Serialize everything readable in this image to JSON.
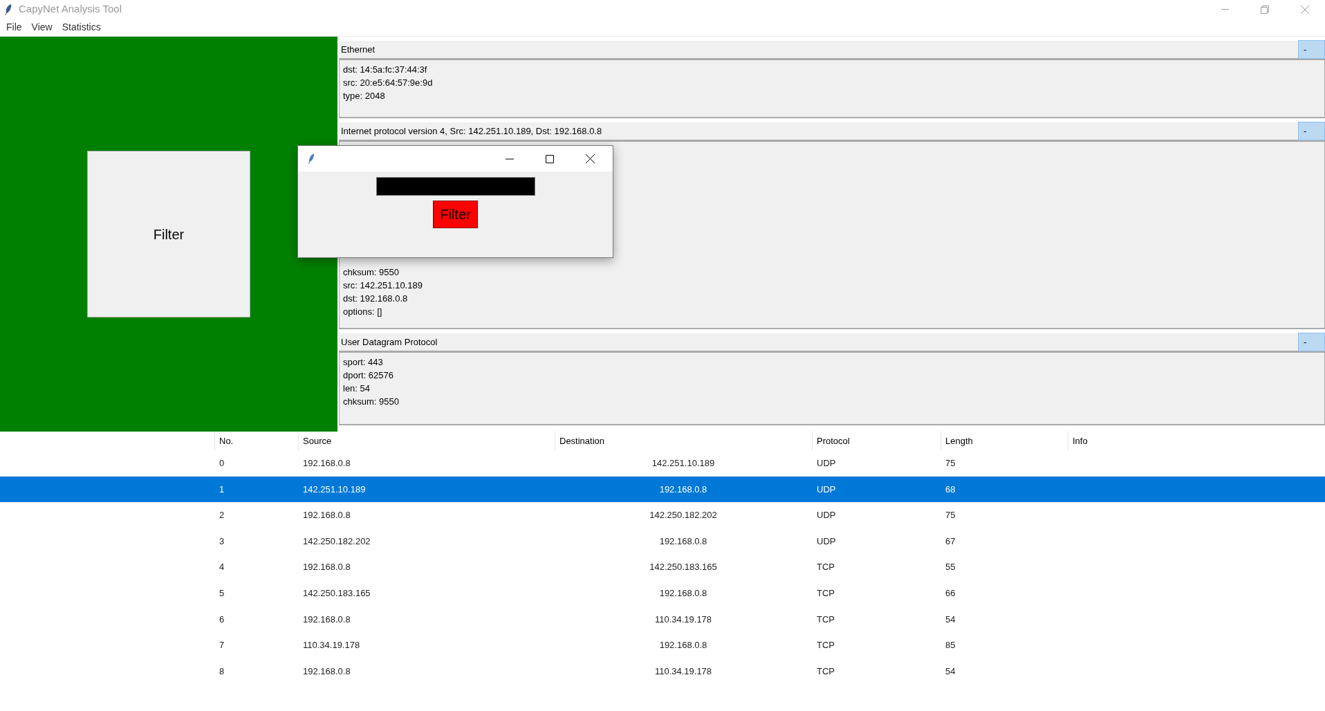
{
  "window": {
    "title": "CapyNet Analysis Tool"
  },
  "menu": [
    "File",
    "View",
    "Statistics"
  ],
  "filter_button": "Filter",
  "layers": [
    {
      "title": "Ethernet",
      "toggle": "-",
      "fields": [
        "dst: 14:5a:fc:37:44:3f",
        "src: 20:e5:64:57:9e:9d",
        "type: 2048"
      ]
    },
    {
      "title": "Internet protocol version 4, Src: 142.251.10.189, Dst: 192.168.0.8",
      "toggle": "-",
      "fields": [
        "chksum: 9550",
        "src: 142.251.10.189",
        "dst: 192.168.0.8",
        "options: []"
      ]
    },
    {
      "title": "User Datagram Protocol",
      "toggle": "-",
      "fields": [
        "sport: 443",
        "dport: 62576",
        "len: 54",
        "chksum: 9550"
      ]
    }
  ],
  "table": {
    "columns": [
      "No.",
      "Source",
      "Destination",
      "Protocol",
      "Length",
      "Info"
    ],
    "rows": [
      {
        "cells": [
          "0",
          "192.168.0.8",
          "142.251.10.189",
          "UDP",
          "75"
        ],
        "selected": false
      },
      {
        "cells": [
          "1",
          "142.251.10.189",
          "192.168.0.8",
          "UDP",
          "68"
        ],
        "selected": true
      },
      {
        "cells": [
          "2",
          "192.168.0.8",
          "142.250.182.202",
          "UDP",
          "75"
        ],
        "selected": false
      },
      {
        "cells": [
          "3",
          "142.250.182.202",
          "192.168.0.8",
          "UDP",
          "67"
        ],
        "selected": false
      },
      {
        "cells": [
          "4",
          "192.168.0.8",
          "142.250.183.165",
          "TCP",
          "55"
        ],
        "selected": false
      },
      {
        "cells": [
          "5",
          "142.250.183.165",
          "192.168.0.8",
          "TCP",
          "66"
        ],
        "selected": false
      },
      {
        "cells": [
          "6",
          "192.168.0.8",
          "110.34.19.178",
          "TCP",
          "54"
        ],
        "selected": false
      },
      {
        "cells": [
          "7",
          "110.34.19.178",
          "192.168.0.8",
          "TCP",
          "85"
        ],
        "selected": false
      },
      {
        "cells": [
          "8",
          "192.168.0.8",
          "110.34.19.178",
          "TCP",
          "54"
        ],
        "selected": false
      }
    ]
  },
  "dialog": {
    "button": "Filter"
  }
}
